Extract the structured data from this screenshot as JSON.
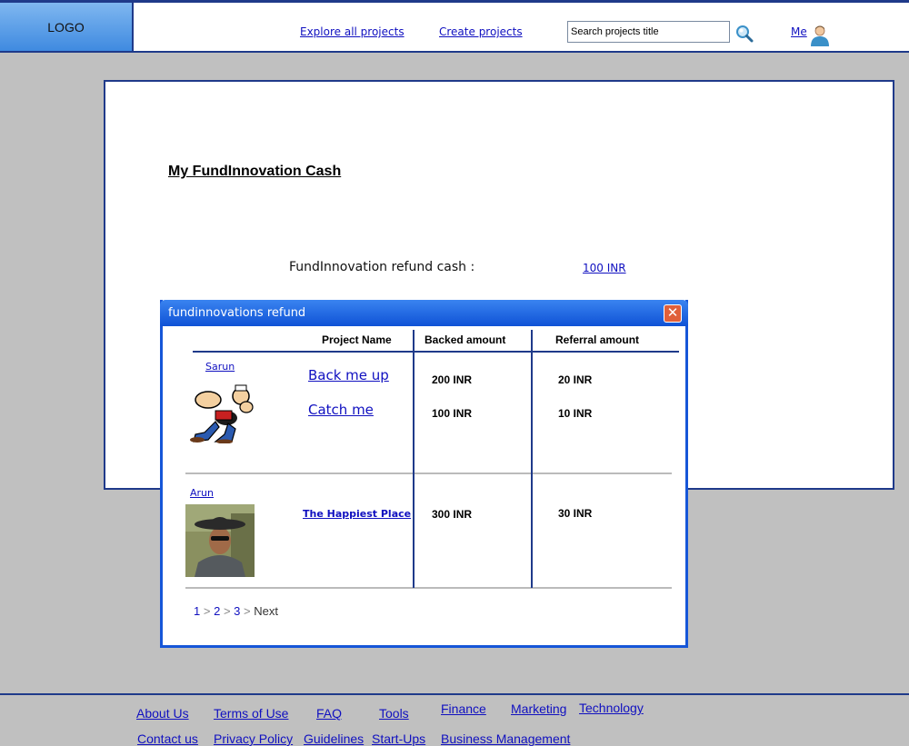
{
  "header": {
    "logo": "LOGO",
    "nav": [
      "Explore all projects",
      "Create projects"
    ],
    "search_placeholder": "Search projects title",
    "me_label": "Me"
  },
  "main": {
    "title": "My FundInnovation Cash",
    "refund_label": "FundInnovation refund cash :",
    "refund_value": "100 INR"
  },
  "dialog": {
    "title": "fundinnovations refund",
    "close_glyph": "✕",
    "columns": [
      "Project Name",
      "Backed amount",
      "Referral amount"
    ],
    "rows": [
      {
        "user": "Sarun",
        "projects": [
          {
            "name": "Back me up",
            "backed": "200 INR",
            "referral": "20 INR"
          },
          {
            "name": "Catch me",
            "backed": "100 INR",
            "referral": "10 INR"
          }
        ]
      },
      {
        "user": "Arun",
        "projects": [
          {
            "name": "The Happiest Place",
            "backed": "300 INR",
            "referral": "30 INR"
          }
        ]
      }
    ],
    "pager": {
      "pages": [
        "1",
        "2",
        "3"
      ],
      "separator": ">",
      "next": "Next"
    }
  },
  "footer": {
    "links": [
      "About Us",
      "Terms of Use",
      "FAQ",
      "Tools",
      "Finance",
      "Marketing",
      "Technology",
      "Contact us",
      "Privacy Policy",
      "Guidelines",
      "Start-Ups",
      "Business Management"
    ]
  },
  "colors": {
    "accent": "#1f3a8a",
    "link": "#1010c0",
    "dialog_title": "#1656d8",
    "background": "#c0c0c0"
  }
}
